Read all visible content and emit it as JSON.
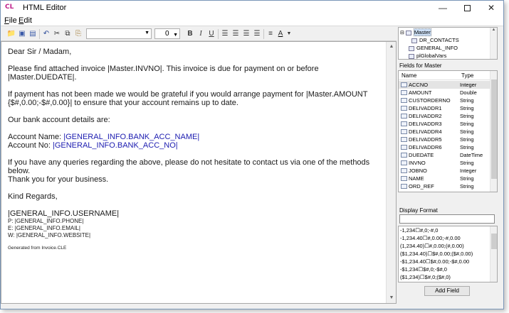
{
  "window": {
    "app_icon": "CL",
    "title": "HTML Editor"
  },
  "menu": [
    "File",
    "Edit"
  ],
  "toolbar": {
    "icons": [
      "open-icon",
      "save-icon",
      "save-as-icon",
      "undo-icon",
      "cut-icon",
      "copy-icon",
      "paste-icon"
    ],
    "font_name": "",
    "font_size": "0",
    "bold": "B",
    "italic": "I",
    "underline": "U",
    "align_icons": [
      "align-left-icon",
      "align-center-icon",
      "align-right-icon",
      "justify-icon"
    ],
    "list_icon": "bullet-list-icon",
    "color_label": "A"
  },
  "editor": {
    "greeting": "Dear Sir / Madam,",
    "line1": "Please find attached invoice |Master.INVNO|.  This invoice is due for payment on or before |Master.DUEDATE|.",
    "line2a": "If payment has not been made we would be grateful if you would arrange payment for |Master.AMOUNT",
    "line2b": "{$#,0.00;-$#,0.00}| to ensure that your account remains up to date.",
    "line3": "Our bank account details are:",
    "acct_name_label": "Account Name: ",
    "acct_name_field": "|GENERAL_INFO.BANK_ACC_NAME|",
    "acct_no_label": "Account No: ",
    "acct_no_field": "|GENERAL_INFO.BANK_ACC_NO|",
    "line4a": "If you have any queries regarding the above, please do not hesitate to contact us via one of the methods below.",
    "line4b": "Thank you for your business.",
    "regards": "Kind Regards,",
    "username": "|GENERAL_INFO.USERNAME|",
    "phone": "P: |GENERAL_INFO.PHONE|",
    "email": "E: |GENERAL_INFO.EMAIL|",
    "website": "W: |GENERAL_INFO.WEBSITE|",
    "footer": "Generated from Invoice.CLE"
  },
  "tree": {
    "items": [
      "Master",
      "DR_CONTACTS",
      "GENERAL_INFO",
      "plGlobalVars"
    ]
  },
  "fields": {
    "label": "Fields for Master",
    "col_name": "Name",
    "col_type": "Type",
    "rows": [
      {
        "name": "ACCNO",
        "type": "Integer"
      },
      {
        "name": "AMOUNT",
        "type": "Double"
      },
      {
        "name": "CUSTORDERNO",
        "type": "String"
      },
      {
        "name": "DELIVADDR1",
        "type": "String"
      },
      {
        "name": "DELIVADDR2",
        "type": "String"
      },
      {
        "name": "DELIVADDR3",
        "type": "String"
      },
      {
        "name": "DELIVADDR4",
        "type": "String"
      },
      {
        "name": "DELIVADDR5",
        "type": "String"
      },
      {
        "name": "DELIVADDR6",
        "type": "String"
      },
      {
        "name": "DUEDATE",
        "type": "DateTime"
      },
      {
        "name": "INVNO",
        "type": "String"
      },
      {
        "name": "JOBNO",
        "type": "Integer"
      },
      {
        "name": "NAME",
        "type": "String"
      },
      {
        "name": "ORD_REF",
        "type": "String"
      }
    ]
  },
  "display_format": {
    "label": "Display Format",
    "input_value": "",
    "options": [
      "-1,234☐#,0;-#,0",
      "-1,234.40☐#,0.00;-#,0.00",
      "(1,234.40)☐#,0.00;(#,0.00)",
      "($1,234.40)☐$#,0.00;($#,0.00)",
      "-$1,234.40☐$#,0.00;-$#,0.00",
      "-$1,234☐$#,0;-$#,0",
      "($1,234)☐$#,0;($#,0)"
    ]
  },
  "add_field_button": "Add Field"
}
